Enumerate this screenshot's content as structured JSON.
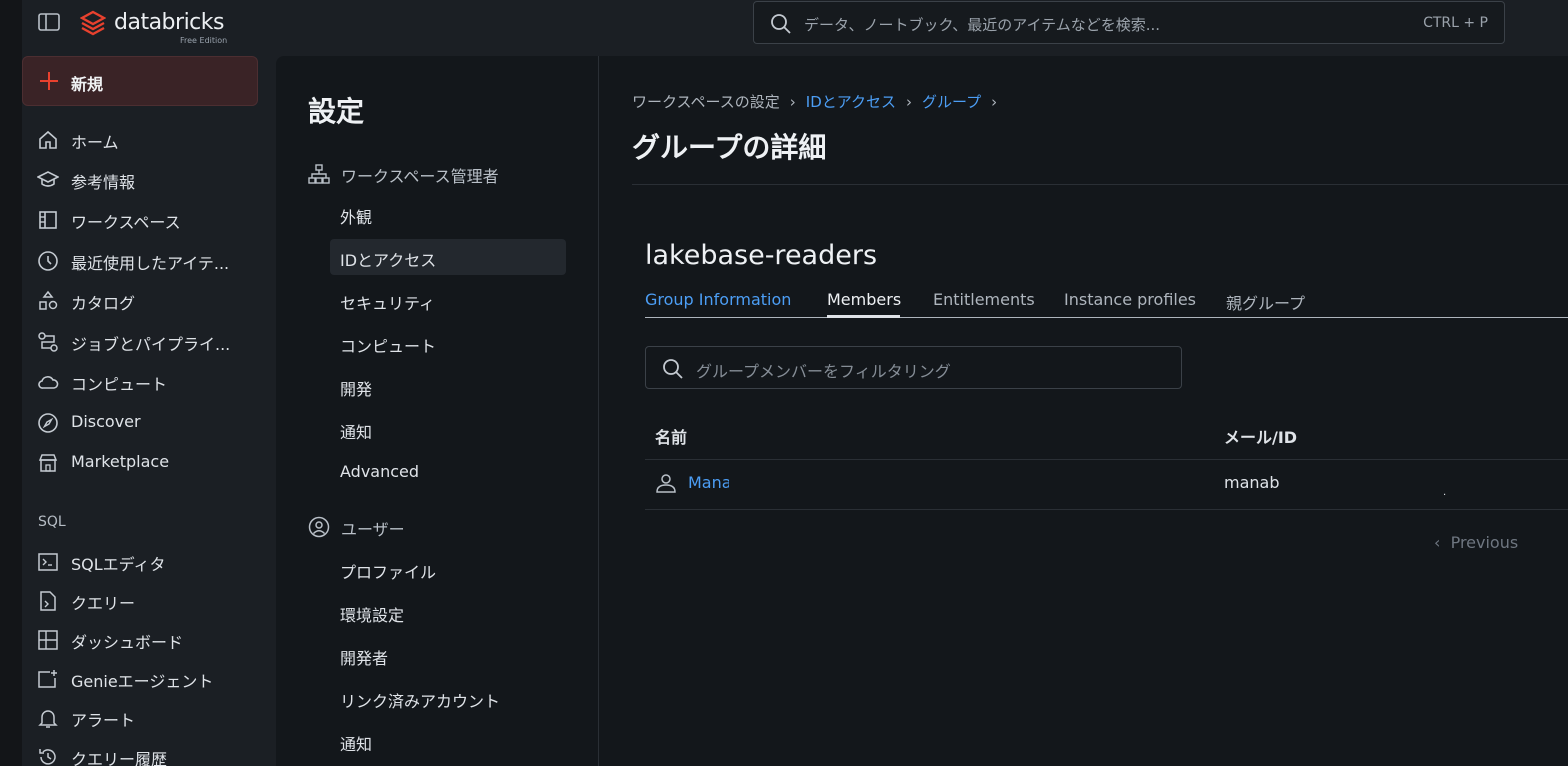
{
  "topbar": {
    "brand": "databricks",
    "edition": "Free Edition",
    "search_placeholder": "データ、ノートブック、最近のアイテムなどを検索...",
    "search_shortcut": "CTRL + P"
  },
  "leftnav": {
    "new_label": "新規",
    "items": [
      {
        "label": "ホーム",
        "icon": "home-icon"
      },
      {
        "label": "参考情報",
        "icon": "graduation-cap-icon"
      },
      {
        "label": "ワークスペース",
        "icon": "workspace-icon"
      },
      {
        "label": "最近使用したアイテ...",
        "icon": "clock-icon"
      },
      {
        "label": "カタログ",
        "icon": "catalog-icon"
      },
      {
        "label": "ジョブとパイプライ...",
        "icon": "workflow-icon"
      },
      {
        "label": "コンピュート",
        "icon": "cloud-icon"
      },
      {
        "label": "Discover",
        "icon": "compass-icon"
      },
      {
        "label": "Marketplace",
        "icon": "store-icon"
      }
    ],
    "sql_section": "SQL",
    "sql_items": [
      {
        "label": "SQLエディタ",
        "icon": "sql-editor-icon"
      },
      {
        "label": "クエリー",
        "icon": "query-file-icon"
      },
      {
        "label": "ダッシュボード",
        "icon": "dashboard-icon"
      },
      {
        "label": "Genieエージェント",
        "icon": "genie-icon"
      },
      {
        "label": "アラート",
        "icon": "bell-icon"
      },
      {
        "label": "クエリー履歴",
        "icon": "history-icon"
      }
    ]
  },
  "settings": {
    "title": "設定",
    "admin_section": "ワークスペース管理者",
    "admin_items": [
      "外観",
      "IDとアクセス",
      "セキュリティ",
      "コンピュート",
      "開発",
      "通知",
      "Advanced"
    ],
    "user_section": "ユーザー",
    "user_items": [
      "プロファイル",
      "環境設定",
      "開発者",
      "リンク済みアカウント",
      "通知"
    ]
  },
  "main": {
    "breadcrumb": [
      "ワークスペースの設定",
      "IDとアクセス",
      "グループ"
    ],
    "title": "グループの詳細",
    "group_name": "lakebase-readers",
    "tabs": [
      "Group Information",
      "Members",
      "Entitlements",
      "Instance profiles",
      "親グループ"
    ],
    "active_tab": "Members",
    "filter_placeholder": "グループメンバーをフィルタリング",
    "columns": [
      "名前",
      "メール/ID"
    ],
    "rows": [
      {
        "name": "Manab",
        "email": "manab"
      }
    ],
    "pager_prev": "Previous"
  },
  "colors": {
    "accent_link": "#4c9ef5",
    "brand_red": "#e8412e",
    "background": "#13171b"
  }
}
